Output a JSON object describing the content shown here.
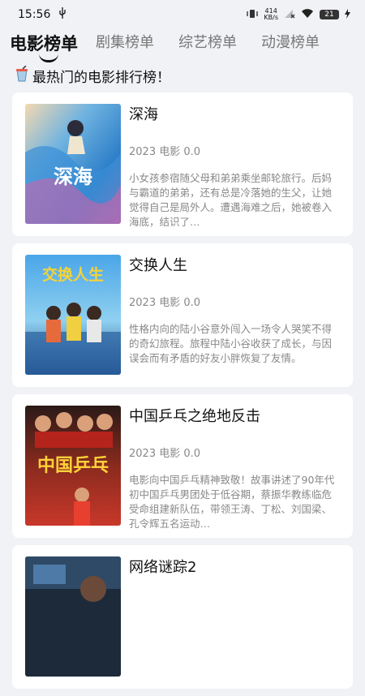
{
  "status_bar": {
    "time": "15:56",
    "usb_icon": "usb-icon",
    "net_speed": "414",
    "net_unit": "KB/s",
    "battery": "21"
  },
  "tabs": [
    {
      "label": "电影榜单",
      "active": true
    },
    {
      "label": "剧集榜单",
      "active": false
    },
    {
      "label": "综艺榜单",
      "active": false
    },
    {
      "label": "动漫榜单",
      "active": false
    }
  ],
  "headline": {
    "icon": "drink-cup-icon",
    "text": "最热门的电影排行榜！"
  },
  "movies": [
    {
      "title": "深海",
      "meta": "2023 电影 0.0",
      "description": "小女孩参宿随父母和弟弟乘坐邮轮旅行。后妈与霸道的弟弟，还有总是冷落她的生父，让她觉得自己是局外人。遭遇海难之后，她被卷入海底，结识了…",
      "poster_text": "深海"
    },
    {
      "title": "交换人生",
      "meta": "2023 电影 0.0",
      "description": "性格内向的陆小谷意外闯入一场令人哭笑不得的奇幻旅程。旅程中陆小谷收获了成长，与因误会而有矛盾的好友小胖恢复了友情。",
      "poster_text": "交换人生"
    },
    {
      "title": "中国乒乓之绝地反击",
      "meta": "2023 电影 0.0",
      "description": "电影向中国乒乓精神致敬！故事讲述了90年代初中国乒乓男团处于低谷期，蔡振华教练临危受命组建新队伍，带领王涛、丁松、刘国梁、孔令辉五名运动…",
      "poster_text": "中国乒乓"
    },
    {
      "title": "网络谜踪2",
      "meta": "",
      "description": "",
      "poster_text": ""
    }
  ]
}
